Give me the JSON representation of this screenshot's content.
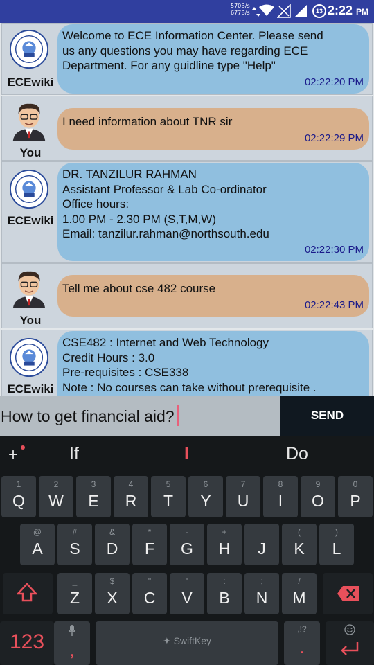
{
  "status_bar": {
    "net_up": "570B/s",
    "net_down": "677B/s",
    "notification_count": "13",
    "time": "2:22",
    "ampm": "PM"
  },
  "messages": [
    {
      "sender": "ECEwiki",
      "type": "bot",
      "text": "Welcome to ECE Information Center. Please send\nus any questions you may have regarding ECE\nDepartment. For any guidline type \"Help\"",
      "time": "02:22:20 PM"
    },
    {
      "sender": "You",
      "type": "user",
      "text": "I need information about TNR sir",
      "time": "02:22:29 PM"
    },
    {
      "sender": "ECEwiki",
      "type": "bot",
      "text": "DR. TANZILUR RAHMAN\nAssistant Professor & Lab Co-ordinator\nOffice hours:\n1.00 PM - 2.30 PM (S,T,M,W)\nEmail: tanzilur.rahman@northsouth.edu",
      "time": "02:22:30 PM"
    },
    {
      "sender": "You",
      "type": "user",
      "text": "Tell me about cse 482 course",
      "time": "02:22:43 PM"
    },
    {
      "sender": "ECEwiki",
      "type": "bot",
      "text": "CSE482 : Internet and Web Technology\nCredit Hours : 3.0\nPre-requisites : CSE338\nNote : No courses can take without prerequisite .",
      "time": ""
    }
  ],
  "input": {
    "value": "How to get financial aid?",
    "send_label": "SEND"
  },
  "keyboard": {
    "suggestions": [
      "If",
      "I",
      "Do"
    ],
    "plus": "+",
    "row1": [
      {
        "main": "Q",
        "hint": "1"
      },
      {
        "main": "W",
        "hint": "2"
      },
      {
        "main": "E",
        "hint": "3"
      },
      {
        "main": "R",
        "hint": "4"
      },
      {
        "main": "T",
        "hint": "5"
      },
      {
        "main": "Y",
        "hint": "6"
      },
      {
        "main": "U",
        "hint": "7"
      },
      {
        "main": "I",
        "hint": "8"
      },
      {
        "main": "O",
        "hint": "9"
      },
      {
        "main": "P",
        "hint": "0"
      }
    ],
    "row2": [
      {
        "main": "A",
        "hint": "@"
      },
      {
        "main": "S",
        "hint": "#"
      },
      {
        "main": "D",
        "hint": "&"
      },
      {
        "main": "F",
        "hint": "*"
      },
      {
        "main": "G",
        "hint": "-"
      },
      {
        "main": "H",
        "hint": "+"
      },
      {
        "main": "J",
        "hint": "="
      },
      {
        "main": "K",
        "hint": "("
      },
      {
        "main": "L",
        "hint": ")"
      }
    ],
    "row3": [
      {
        "main": "Z",
        "hint": "_"
      },
      {
        "main": "X",
        "hint": "$"
      },
      {
        "main": "C",
        "hint": "\""
      },
      {
        "main": "V",
        "hint": "'"
      },
      {
        "main": "B",
        "hint": ":"
      },
      {
        "main": "N",
        "hint": ";"
      },
      {
        "main": "M",
        "hint": "/"
      }
    ],
    "numbers_label": "123",
    "comma": ",",
    "space_brand": "SwiftKey",
    "period": ".",
    "period_hint": ",!?",
    "accent_color": "#e8505b"
  }
}
